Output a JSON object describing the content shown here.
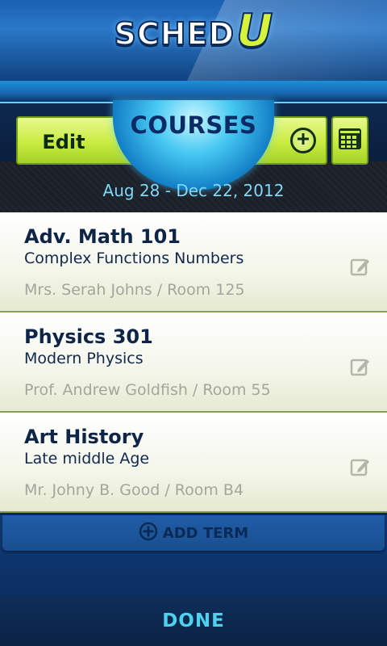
{
  "app": {
    "logo_text": "SCHED",
    "logo_accent": "U",
    "brand_color": "#d7f23a"
  },
  "toolbar": {
    "title": "COURSES",
    "edit_label": "Edit",
    "add_icon": "plus-circle-icon",
    "calendar_icon": "calendar-icon",
    "date_range": "Aug 28 - Dec 22, 2012"
  },
  "courses": [
    {
      "name": "Adv. Math 101",
      "subtitle": "Complex Functions Numbers",
      "teacher": "Mrs. Serah Johns / Room 125"
    },
    {
      "name": "Physics 301",
      "subtitle": "Modern Physics",
      "teacher": "Prof. Andrew Goldfish / Room 55"
    },
    {
      "name": "Art History",
      "subtitle": "Late middle Age",
      "teacher": "Mr. Johny B. Good / Room B4"
    }
  ],
  "add_term": {
    "label": "ADD TERM",
    "icon": "plus-circle-icon"
  },
  "done": {
    "label": "DONE"
  },
  "colors": {
    "accent_green": "#c9ec3f",
    "navy": "#0c2b66",
    "cyan_text": "#7ed8f6",
    "muted_text": "#a4a59c"
  }
}
